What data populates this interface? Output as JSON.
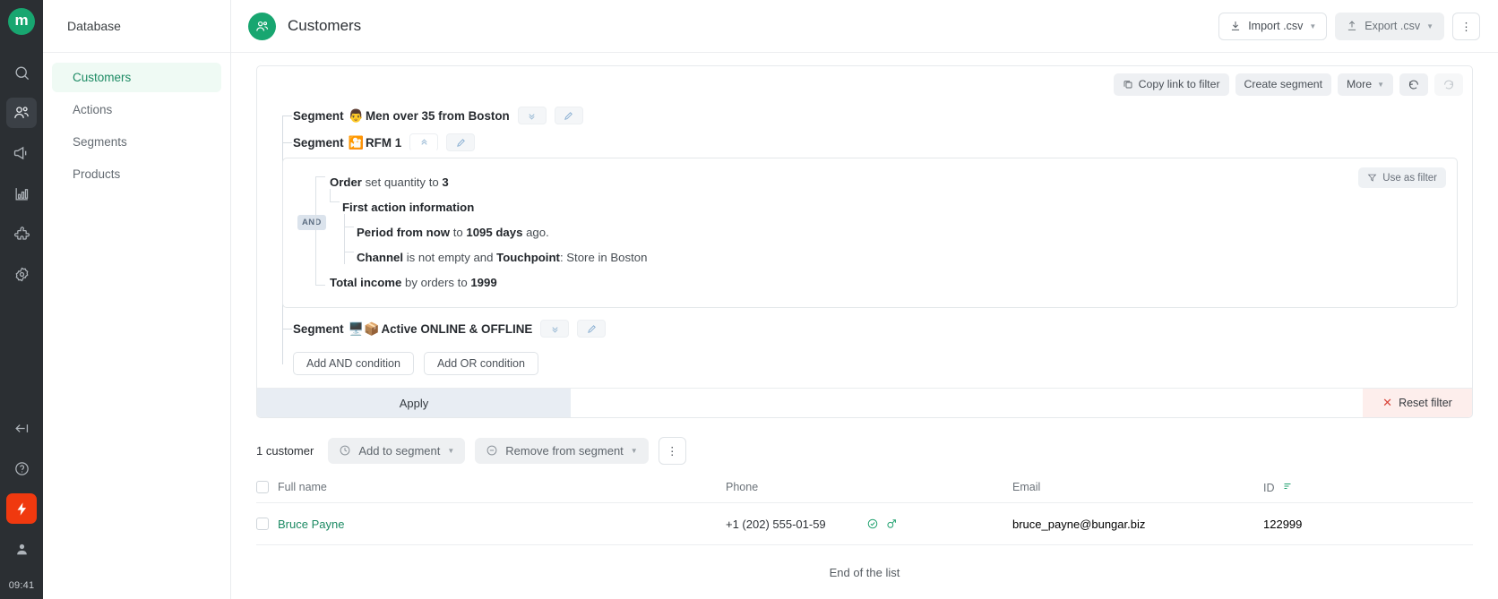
{
  "rail": {
    "logo_letter": "m",
    "items": [
      {
        "name": "search-icon",
        "label": "Search"
      },
      {
        "name": "audience-icon",
        "label": "Audience",
        "active": true
      },
      {
        "name": "campaigns-icon",
        "label": "Campaigns"
      },
      {
        "name": "analytics-icon",
        "label": "Analytics"
      },
      {
        "name": "integrations-icon",
        "label": "Integrations"
      },
      {
        "name": "settings-icon",
        "label": "Settings"
      }
    ],
    "bottom": [
      {
        "name": "collapse-icon",
        "label": "Collapse"
      },
      {
        "name": "help-icon",
        "label": "Help"
      },
      {
        "name": "quick-actions-icon",
        "label": "Quick actions"
      },
      {
        "name": "account-icon",
        "label": "Account"
      }
    ],
    "time": "09:41"
  },
  "sidebar": {
    "title": "Database",
    "items": [
      {
        "label": "Customers",
        "active": true
      },
      {
        "label": "Actions",
        "active": false
      },
      {
        "label": "Segments",
        "active": false
      },
      {
        "label": "Products",
        "active": false
      }
    ]
  },
  "header": {
    "title": "Customers",
    "import_label": "Import .csv",
    "export_label": "Export .csv",
    "more_menu_label": "⋮"
  },
  "filter": {
    "toolbar": {
      "copy_link": "Copy link to filter",
      "create_segment": "Create segment",
      "more": "More",
      "undo_icon": "undo-icon",
      "redo_icon": "redo-icon"
    },
    "segments": [
      {
        "prefix": "Segment",
        "emoji": "👨",
        "name": "Men over 35 from Boston",
        "collapse_state": "collapsed"
      },
      {
        "prefix": "Segment",
        "emoji": "🎦",
        "name": "RFM 1",
        "collapse_state": "expanded"
      },
      {
        "prefix": "Segment",
        "emoji": "🖥️📦",
        "name": "Active ONLINE & OFFLINE",
        "collapse_state": "collapsed"
      }
    ],
    "use_as_filter": "Use as filter",
    "and_badge": "AND",
    "conditions": [
      {
        "level": 1,
        "parts": [
          {
            "t": "Order",
            "b": true
          },
          {
            "t": " set quantity to ",
            "b": false
          },
          {
            "t": "3",
            "b": true
          }
        ]
      },
      {
        "level": 2,
        "parts": [
          {
            "t": "First action information",
            "b": true
          }
        ]
      },
      {
        "level": 3,
        "parts": [
          {
            "t": "Period from now",
            "b": true
          },
          {
            "t": " to ",
            "b": false
          },
          {
            "t": "1095 days",
            "b": true
          },
          {
            "t": " ago.",
            "b": false
          }
        ]
      },
      {
        "level": 3,
        "parts": [
          {
            "t": "Channel",
            "b": true
          },
          {
            "t": " is not empty and ",
            "b": false
          },
          {
            "t": "Touchpoint",
            "b": true
          },
          {
            "t": ": Store in Boston",
            "b": false
          }
        ]
      },
      {
        "level": 1,
        "parts": [
          {
            "t": "Total income",
            "b": true
          },
          {
            "t": " by orders to ",
            "b": false
          },
          {
            "t": "1999",
            "b": true
          }
        ]
      }
    ],
    "add_and": "Add AND condition",
    "add_or": "Add OR condition",
    "apply": "Apply",
    "reset": "Reset filter"
  },
  "list": {
    "count": "1 customer",
    "add_to_segment": "Add to segment",
    "remove_from_segment": "Remove from segment",
    "row_more_label": "⋮"
  },
  "table": {
    "columns": [
      "Full name",
      "Phone",
      "Email",
      "ID"
    ],
    "rows": [
      {
        "full_name": "Bruce Payne",
        "phone": "+1 (202) 555-01-59",
        "email": "bruce_payne@bungar.biz",
        "id": "122999"
      }
    ],
    "end_of_list": "End of the list"
  },
  "colors": {
    "brand_green": "#18a670",
    "accent_orange": "#f0390f",
    "rail_dark": "#2b2f33",
    "apply_bg": "#e8edf3",
    "reset_bg": "#fdeeec"
  }
}
